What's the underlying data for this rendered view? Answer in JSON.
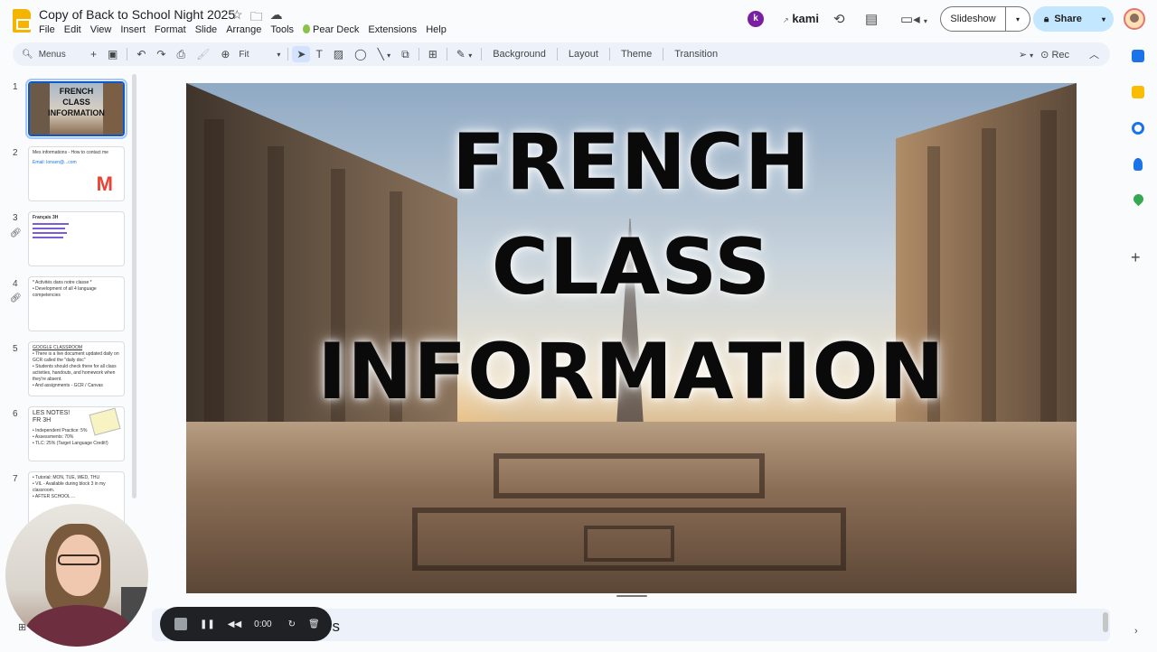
{
  "app": {
    "title": "Copy of Back to School Night 2025"
  },
  "menu": [
    "File",
    "Edit",
    "View",
    "Insert",
    "Format",
    "Slide",
    "Arrange",
    "Tools",
    "Pear Deck",
    "Extensions",
    "Help"
  ],
  "header": {
    "kami_label": "kami",
    "slideshow_label": "Slideshow",
    "share_label": "Share"
  },
  "toolbar": {
    "search_placeholder": "Menus",
    "zoom": "Fit",
    "background_label": "Background",
    "layout_label": "Layout",
    "theme_label": "Theme",
    "transition_label": "Transition",
    "rec_label": "Rec"
  },
  "slides": [
    {
      "num": "1",
      "title_lines": [
        "FRENCH",
        "CLASS",
        "INFORMATION"
      ]
    },
    {
      "num": "2",
      "lines": [
        "Mes informations - How to contact me",
        "Email: lonsen@...com"
      ]
    },
    {
      "num": "3",
      "lines": [
        "Français 3H"
      ]
    },
    {
      "num": "4",
      "lines": [
        "* Activités dans notre classe *",
        "• Development of all 4 language competencies"
      ]
    },
    {
      "num": "5",
      "lines": [
        "GOOGLE CLASSROOM",
        "• There is a live document updated daily on GCR called the \"daily doc\"",
        "• Students should check there for all class activities, handouts, and homework when they're absent.",
        "• And assignments - GCR / Canvas"
      ]
    },
    {
      "num": "6",
      "lines": [
        "LES NOTES!",
        "FR 3H",
        "• Independent Practice: 5%",
        "• Assessments: 70%",
        "• TLC: 25% (Target Language Credit!)"
      ]
    },
    {
      "num": "7",
      "lines": [
        "• Tutorial: MON, TUE, WED, THU",
        "• VIL - Available during block 3 in my classroom.",
        "• AFTER SCHOOL ..."
      ]
    }
  ],
  "slide": {
    "title_lines": [
      "FRENCH",
      "CLASS",
      "INFORMATION"
    ]
  },
  "notes": {
    "text": "es"
  },
  "recording": {
    "time": "0:00"
  },
  "colors": {
    "accent": "#0b57d0",
    "share_bg": "#c2e7ff",
    "toolbar_bg": "#edf2fa",
    "logo": "#f4b400"
  },
  "icons": [
    "star-icon",
    "folder-move-icon",
    "cloud-status-icon",
    "history-icon",
    "comment-icon",
    "video-call-icon",
    "lock-icon",
    "search-icon",
    "undo-icon",
    "redo-icon",
    "print-icon",
    "paint-format-icon",
    "zoom-icon",
    "cursor-icon",
    "textbox-icon",
    "image-icon",
    "shape-icon",
    "line-icon",
    "comment-add-icon",
    "pen-icon",
    "chevron-up-icon"
  ]
}
